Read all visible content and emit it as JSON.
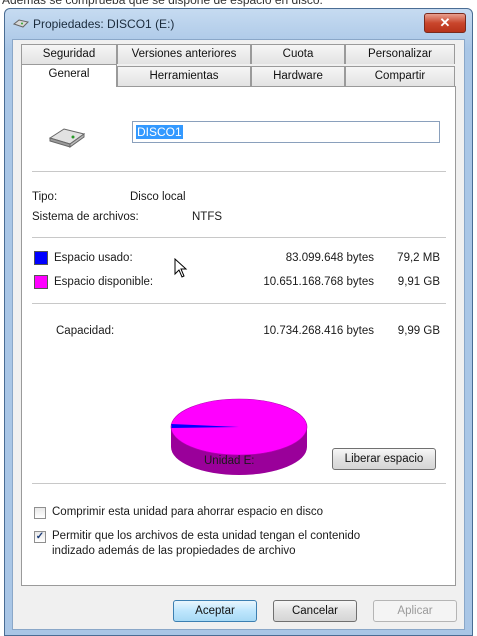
{
  "window": {
    "title": "Propiedades: DISCO1 (E:)",
    "close_label": "✕"
  },
  "tabs_row1": [
    "Seguridad",
    "Versiones anteriores",
    "Cuota",
    "Personalizar"
  ],
  "tabs_row2": [
    "General",
    "Herramientas",
    "Hardware",
    "Compartir"
  ],
  "general": {
    "drive_name": "DISCO1",
    "type_label": "Tipo:",
    "type_value": "Disco local",
    "fs_label": "Sistema de archivos:",
    "fs_value": "NTFS",
    "used": {
      "label": "Espacio usado:",
      "bytes": "83.099.648 bytes",
      "size": "79,2 MB",
      "color": "#0000ff"
    },
    "free": {
      "label": "Espacio disponible:",
      "bytes": "10.651.168.768 bytes",
      "size": "9,91 GB",
      "color": "#ff00ff"
    },
    "capacity": {
      "label": "Capacidad:",
      "bytes": "10.734.268.416 bytes",
      "size": "9,99 GB"
    },
    "used_fraction": 0.0077,
    "drive_caption": "Unidad E:",
    "cleanup_button": "Liberar espacio",
    "compress": {
      "label": "Comprimir esta unidad para ahorrar espacio en disco",
      "checked": false
    },
    "index": {
      "line1": "Permitir que los archivos de esta unidad tengan el contenido",
      "line2": "indizado además de las propiedades de archivo",
      "checked": true
    }
  },
  "buttons": {
    "ok": "Aceptar",
    "cancel": "Cancelar",
    "apply": "Aplicar"
  }
}
